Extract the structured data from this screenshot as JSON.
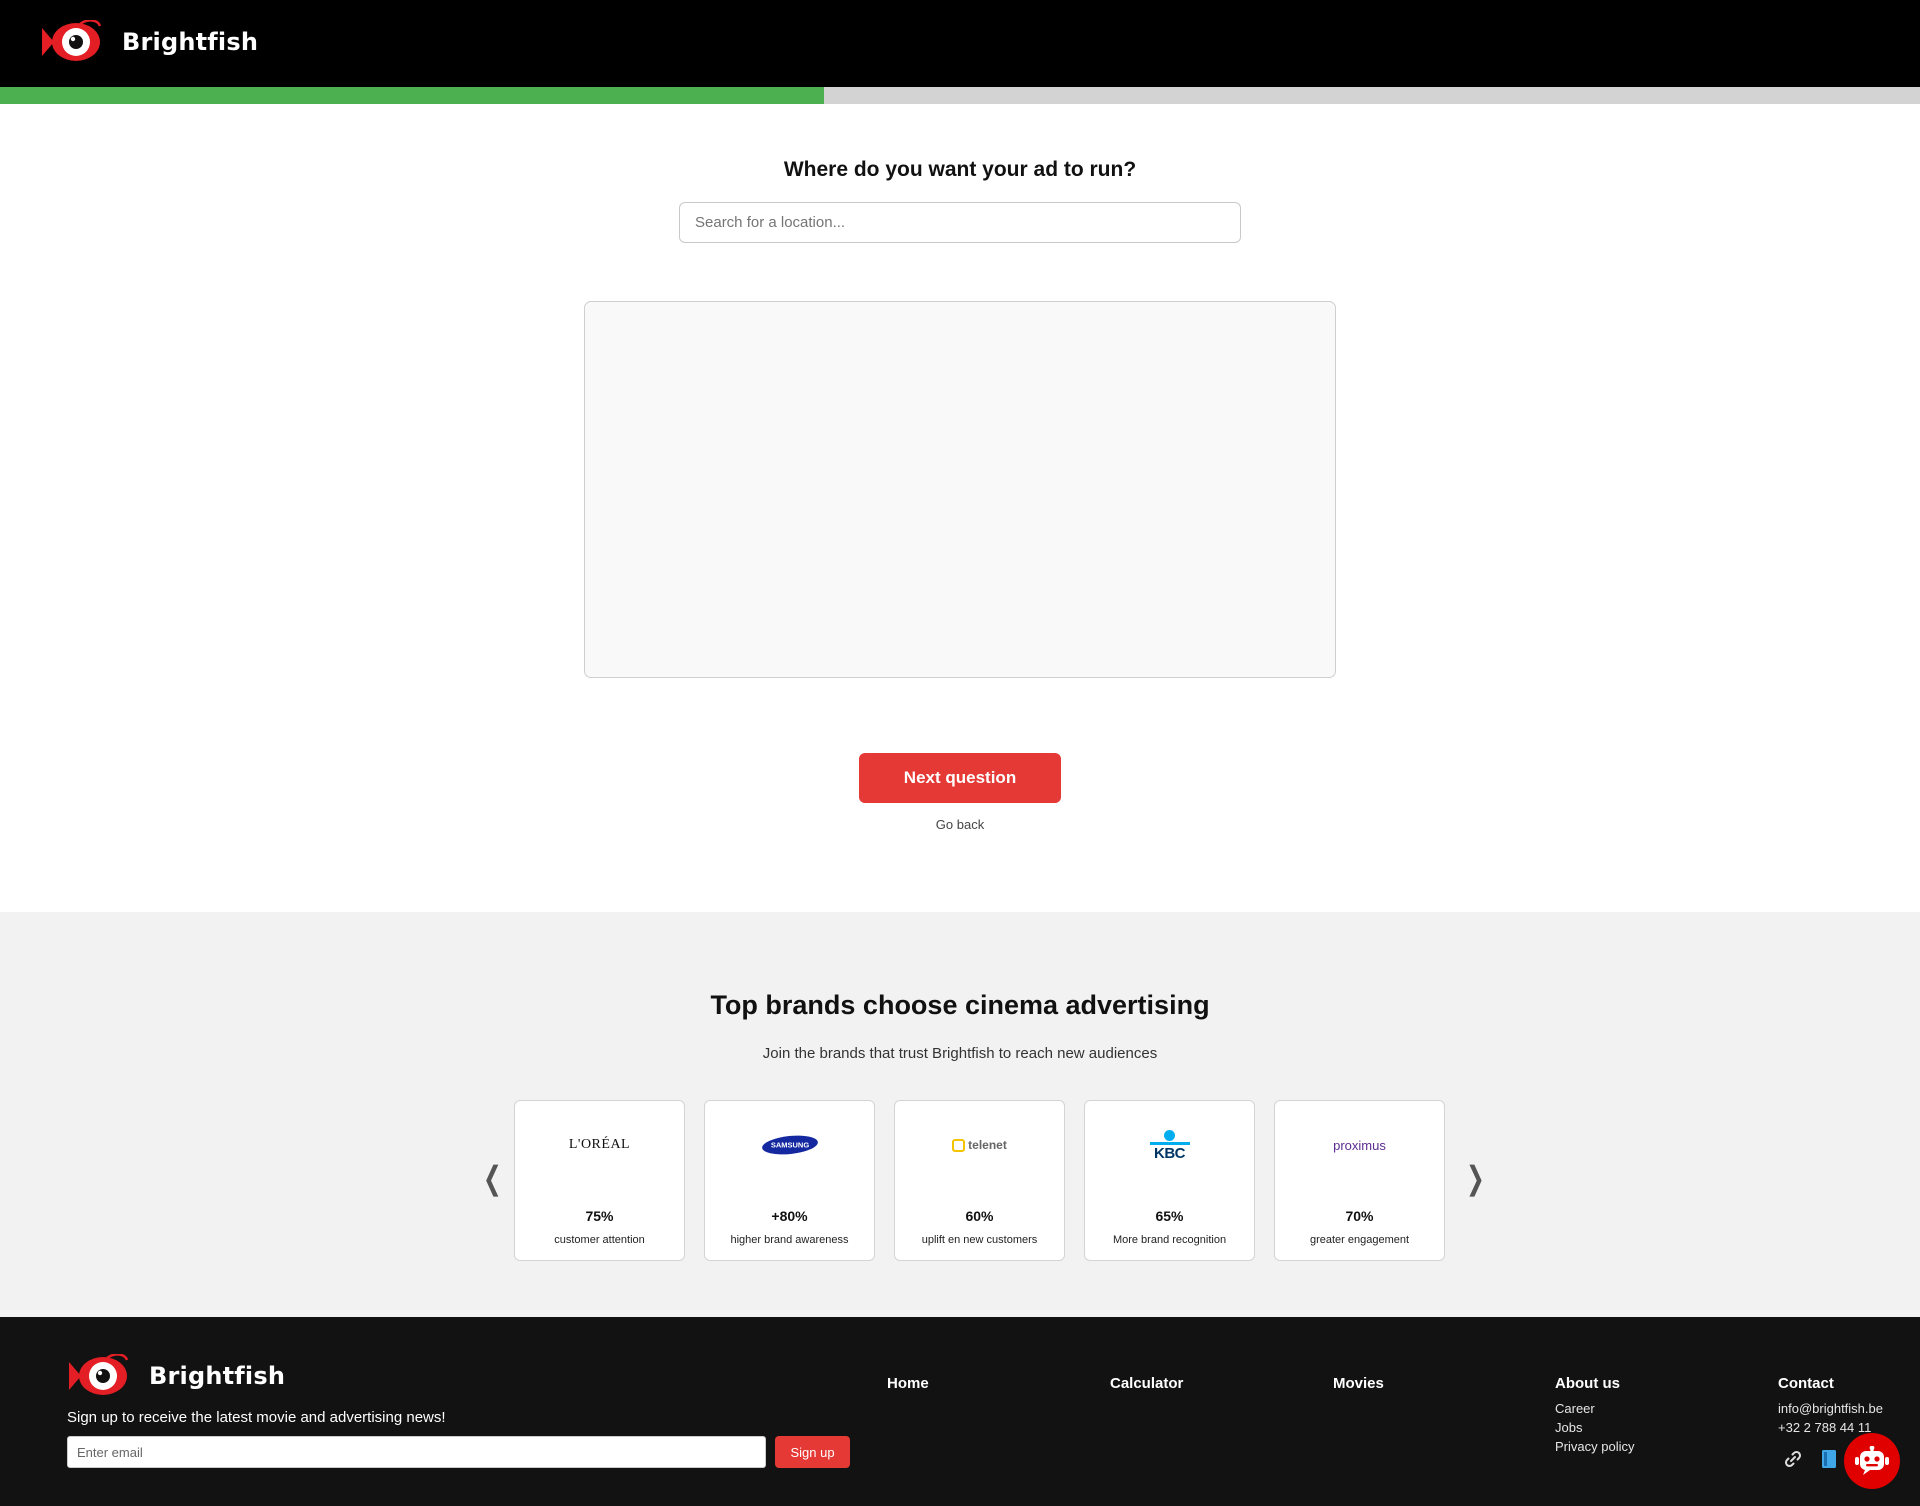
{
  "header": {
    "logo_text": "Brightfish"
  },
  "progress": {
    "percent": 42.9
  },
  "question": {
    "title": "Where do you want your ad to run?",
    "search_placeholder": "Search for a location...",
    "next_label": "Next question",
    "back_label": "Go back"
  },
  "brands": {
    "title": "Top brands choose cinema advertising",
    "subtitle": "Join the brands that trust Brightfish to reach new audiences",
    "prev_icon": "chevron-left-icon",
    "next_icon": "chevron-right-icon",
    "cards": [
      {
        "brand": "L'ORÉAL",
        "stat": "75%",
        "label": "customer attention"
      },
      {
        "brand": "SAMSUNG",
        "stat": "+80%",
        "label": "higher brand awareness"
      },
      {
        "brand": "telenet",
        "stat": "60%",
        "label": "uplift en new customers"
      },
      {
        "brand": "KBC",
        "stat": "65%",
        "label": "More brand recognition"
      },
      {
        "brand": "proximus",
        "stat": "70%",
        "label": "greater engagement"
      }
    ]
  },
  "footer": {
    "logo_text": "Brightfish",
    "newsletter": "Sign up to receive the latest movie and advertising news!",
    "email_placeholder": "Enter email",
    "signup_label": "Sign up",
    "columns": {
      "home": "Home",
      "calculator": "Calculator",
      "movies": "Movies",
      "about": {
        "title": "About us",
        "links": [
          "Career",
          "Jobs",
          "Privacy policy"
        ]
      },
      "contact": {
        "title": "Contact",
        "email": "info@brightfish.be",
        "phone": "+32 2 788 44 11"
      }
    }
  },
  "colors": {
    "accent_red": "#e53935",
    "progress_green": "#4caf50",
    "header_bg": "#000000",
    "footer_bg": "#121212",
    "brands_bg": "#f2f2f2"
  }
}
